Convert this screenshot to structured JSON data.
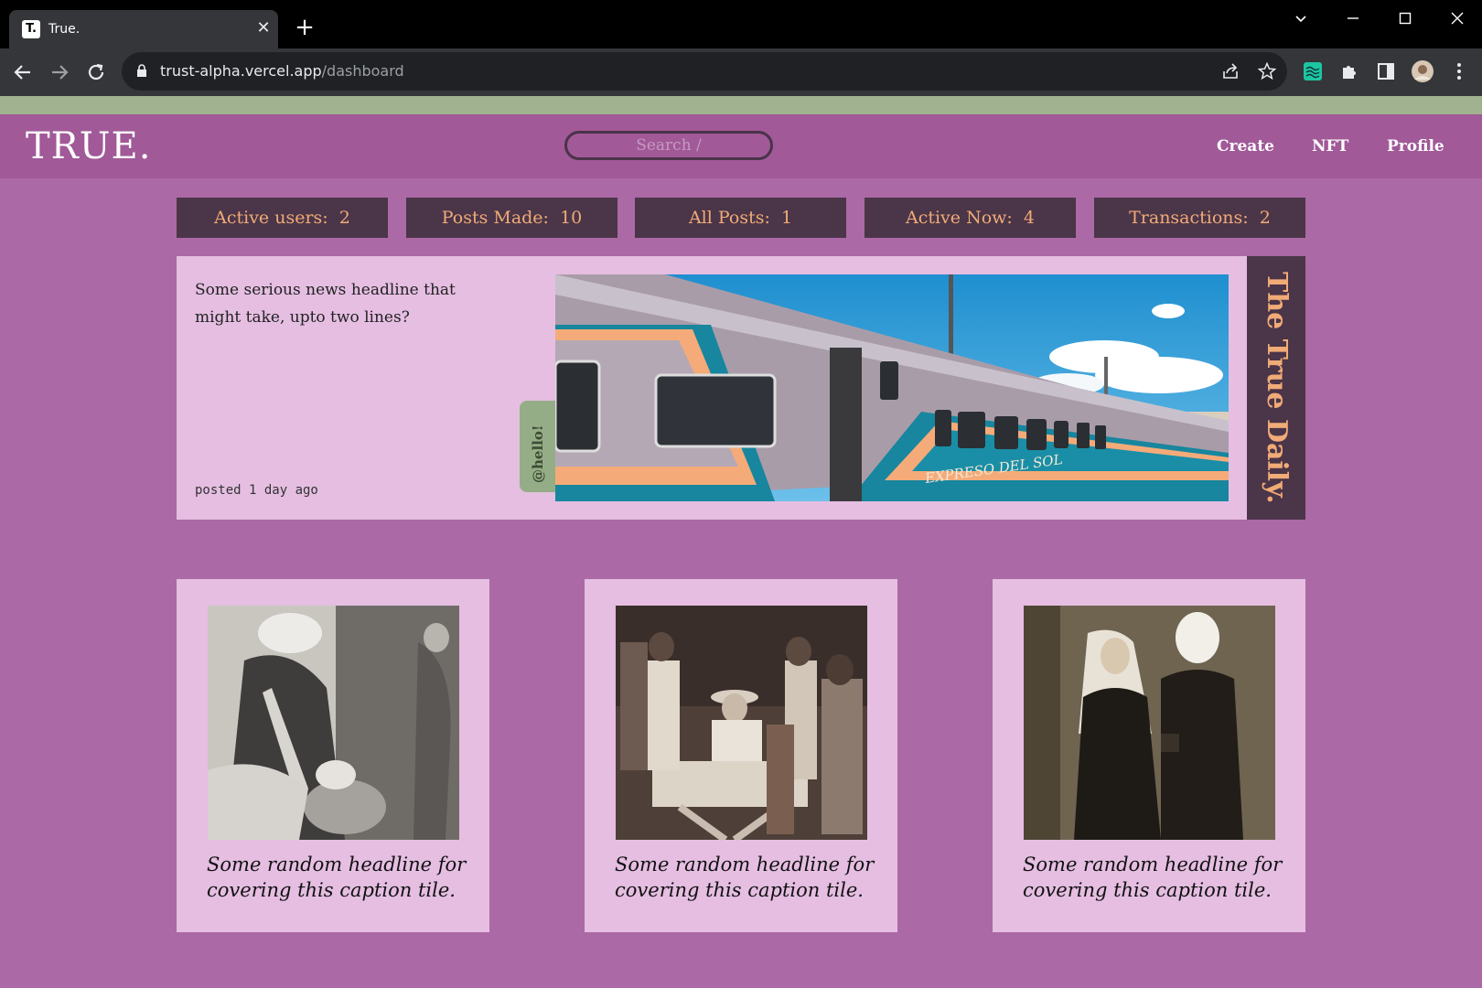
{
  "browser": {
    "tab_favicon": "T.",
    "tab_title": "True.",
    "tab_close": "✕",
    "new_tab": "+",
    "url_host": "trust-alpha.vercel.app",
    "url_path": "/dashboard"
  },
  "site": {
    "logo": "TRUE.",
    "search_placeholder": "Search /",
    "nav": [
      "Create",
      "NFT",
      "Profile"
    ]
  },
  "stats": [
    {
      "label": "Active users:",
      "value": "2"
    },
    {
      "label": "Posts Made:",
      "value": "10"
    },
    {
      "label": "All Posts:",
      "value": "1"
    },
    {
      "label": "Active Now:",
      "value": "4"
    },
    {
      "label": "Transactions:",
      "value": "2"
    }
  ],
  "featured": {
    "headline": "Some serious news headline that might take, upto two lines?",
    "posted": "posted 1 day ago",
    "tag": "@hello!",
    "train_text": "EXPRESO DEL SOL",
    "side_title": "The True Daily."
  },
  "cards": [
    {
      "caption": "Some random headline for covering this caption tile."
    },
    {
      "caption": "Some random headline for covering this caption tile."
    },
    {
      "caption": "Some random headline for covering this caption tile."
    }
  ],
  "colors": {
    "page_bg": "#ab69a5",
    "header_bg": "#a15998",
    "stat_bg": "#4b3548",
    "stat_text": "#f0ab77",
    "card_bg": "#e5bee2",
    "strip": "#a0b28f"
  }
}
